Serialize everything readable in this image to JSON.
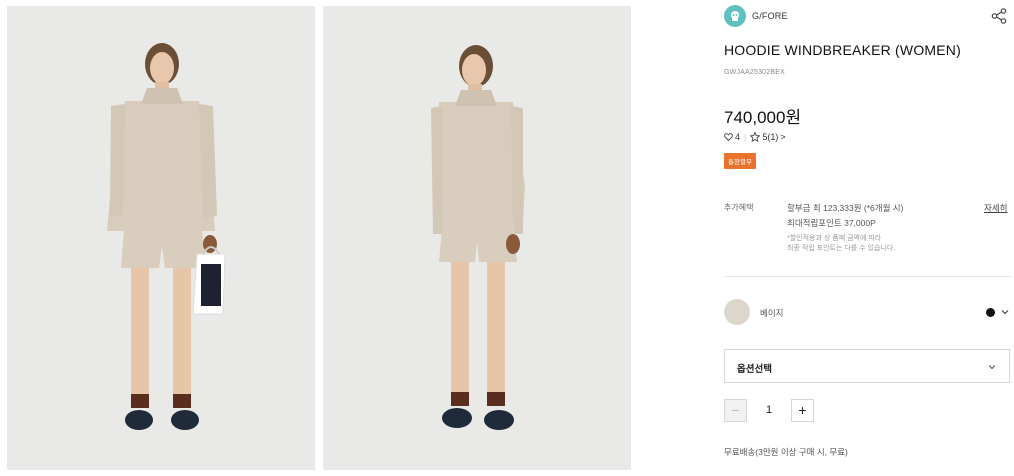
{
  "gallery": {
    "images": [
      {
        "name": "product-photo-front-with-bag"
      },
      {
        "name": "product-photo-front"
      }
    ]
  },
  "product": {
    "brand": "G/FORE",
    "title": "HOODIE WINDBREAKER (WOMEN)",
    "code": "GWJAA25302BEX",
    "price": "740,000원",
    "likes": "4",
    "rating": "5(1)",
    "rating_suffix": ">",
    "badge": "통장할부"
  },
  "benefits": {
    "label": "추가혜택",
    "installment": "할부금 최 123,333원 (*6개월 시)",
    "points": "최대적립포인트 37,000P",
    "note1": "*할인적용과 상 품페 금액에 따라",
    "note2": "최종 적립 포인트는 다를 수 있습니다.",
    "detail_link": "자세히"
  },
  "color": {
    "name": "베이지",
    "swatch_hex": "#dcd6cb",
    "dot_hex": "#111111"
  },
  "option_select": {
    "placeholder": "옵션선택"
  },
  "quantity": {
    "value": "1",
    "minus": "−",
    "plus": "+"
  },
  "shipping": "무료배송(3만원 이상 구매 시, 무료)",
  "colors": {
    "accent": "#e9732d",
    "brand": "#5fc1bf"
  }
}
